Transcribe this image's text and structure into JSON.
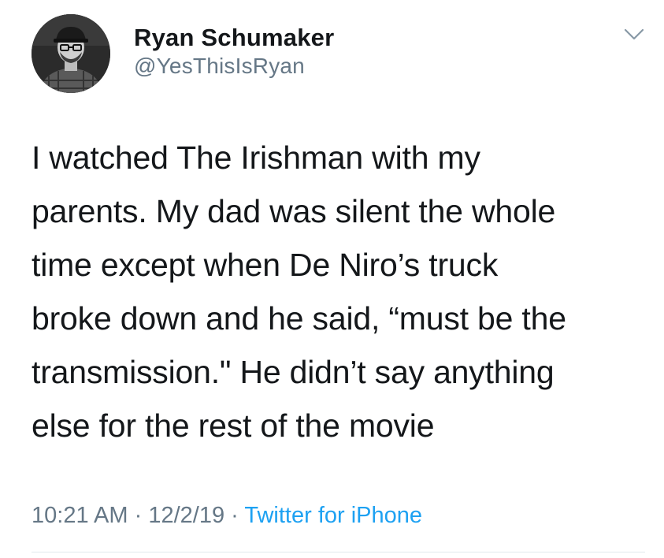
{
  "user": {
    "display_name": "Ryan Schumaker",
    "handle": "@YesThisIsRyan",
    "avatar_icon": "person-avatar-icon"
  },
  "tweet": {
    "lines": [
      "I watched The Irishman with my",
      "parents. My dad was silent the whole",
      "time except when De Niro’s truck",
      "broke down and he said, “must be the",
      "transmission.\" He didn’t say anything",
      "else for the rest of the movie"
    ]
  },
  "meta": {
    "time": "10:21 AM",
    "date": "12/2/19",
    "separator": "·",
    "source": "Twitter for iPhone"
  },
  "colors": {
    "text": "#14171a",
    "muted": "#657786",
    "link": "#1da1f2",
    "divider": "#e1e8ed"
  },
  "icons": {
    "menu": "chevron-down-icon"
  }
}
